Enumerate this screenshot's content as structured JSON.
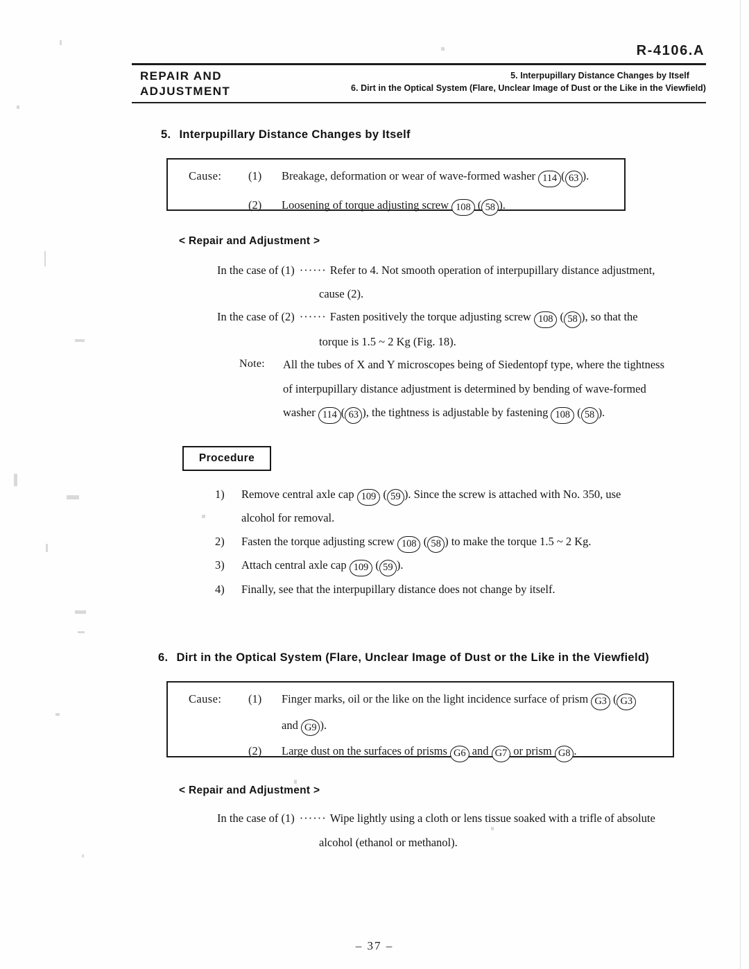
{
  "document": {
    "code": "R-4106.A",
    "page_number": "– 37 –"
  },
  "header": {
    "left_line1": "REPAIR  AND",
    "left_line2": "ADJUSTMENT",
    "right_line1": "5. Interpupillary Distance Changes by Itself",
    "right_line2": "6. Dirt in the Optical System (Flare, Unclear Image of Dust or the Like in the Viewfield)"
  },
  "section5": {
    "number": "5.",
    "title": "Interpupillary Distance Changes by Itself",
    "cause_label": "Cause:",
    "causes": [
      {
        "index": "(1)",
        "text_before": "Breakage, deformation or wear of wave-formed washer",
        "part_a": "114",
        "part_b": "63",
        "text_after": ")."
      },
      {
        "index": "(2)",
        "text_before": "Loosening of torque adjusting screw",
        "part_a": "108",
        "part_b": "58",
        "text_after": ")."
      }
    ],
    "repair_heading": "< Repair and Adjustment >",
    "case1": {
      "lead": "In the case of (1)",
      "dots": "······",
      "line1": "Refer to 4.  Not smooth operation of interpupillary distance adjustment,",
      "line2": "cause (2)."
    },
    "case2": {
      "lead": "In the case of (2)",
      "dots": "······",
      "line1_before": "Fasten positively the torque adjusting screw",
      "part_a": "108",
      "part_b": "58",
      "line1_after": "), so that the",
      "line2": "torque is 1.5 ~ 2 Kg (Fig. 18)."
    },
    "note": {
      "label": "Note:",
      "line1": "All the tubes of X and Y microscopes being of Siedentopf type, where the tightness",
      "line2": "of interpupillary distance adjustment is determined by bending of wave-formed",
      "line3_a": "washer",
      "line3_part_a": "114",
      "line3_part_b": "63",
      "line3_b": "), the tightness is adjustable by fastening",
      "line3_part_c": "108",
      "line3_part_d": "58",
      "line3_c": ")."
    },
    "procedure_label": "Procedure",
    "steps": [
      {
        "n": "1)",
        "line1_before": "Remove central axle cap",
        "part_a": "109",
        "part_b": "59",
        "line1_after": ").  Since the screw is attached with No. 350, use",
        "line2": "alcohol for removal."
      },
      {
        "n": "2)",
        "line1_before": "Fasten the torque adjusting screw",
        "part_a": "108",
        "part_b": "58",
        "line1_after": ") to make the torque 1.5 ~ 2 Kg."
      },
      {
        "n": "3)",
        "line1_before": "Attach central axle cap",
        "part_a": "109",
        "part_b": "59",
        "line1_after": ")."
      },
      {
        "n": "4)",
        "line1_before": "Finally, see that the interpupillary distance does not change by itself."
      }
    ]
  },
  "section6": {
    "number": "6.",
    "title": "Dirt in the Optical System (Flare, Unclear Image of Dust or the Like in the Viewfield)",
    "cause_label": "Cause:",
    "cause1": {
      "index": "(1)",
      "line1_before": "Finger marks, oil or the like on the light incidence surface of prism",
      "part_a": "G3",
      "part_b": "G3",
      "line2_before": "and",
      "part_c": "G9",
      "line2_after": ")."
    },
    "cause2": {
      "index": "(2)",
      "text_a": "Large dust on the surfaces of prisms",
      "part_a": "G6",
      "text_b": "and",
      "part_b": "G7",
      "text_c": "or prism",
      "part_c": "G8",
      "text_d": "."
    },
    "repair_heading": "< Repair and Adjustment >",
    "case1": {
      "lead": "In the case of (1)",
      "dots": "······",
      "line1": "Wipe lightly using a cloth or lens tissue soaked with a trifle of absolute",
      "line2": "alcohol (ethanol or methanol)."
    }
  }
}
